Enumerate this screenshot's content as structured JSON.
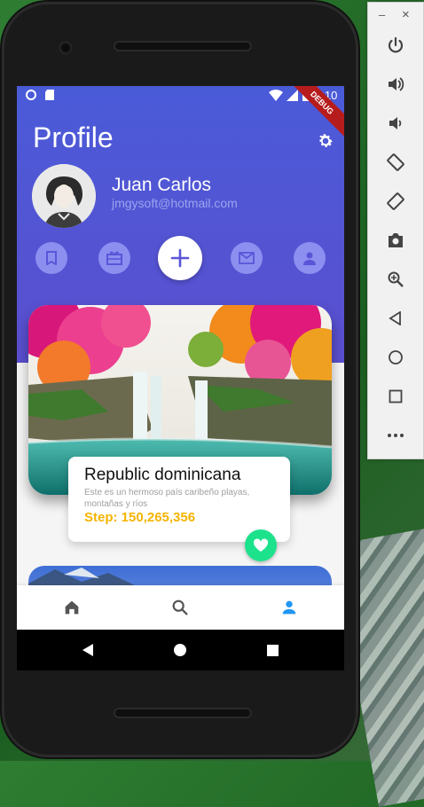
{
  "status_bar": {
    "time": "3:10",
    "debug_banner": "DEBUG"
  },
  "profile": {
    "title": "Profile",
    "name": "Juan Carlos",
    "email": "jmgysoft@hotmail.com"
  },
  "actions": [
    {
      "icon": "bookmark-icon"
    },
    {
      "icon": "gift-card-icon"
    },
    {
      "icon": "plus-icon"
    },
    {
      "icon": "mail-icon"
    },
    {
      "icon": "person-icon"
    }
  ],
  "featured": {
    "title": "Republic dominicana",
    "description": "Este es un hermoso país caribeño playas, montañas y ríos",
    "step": "Step: 150,265,356"
  },
  "bottom_nav": [
    "home-icon",
    "search-icon",
    "person-icon"
  ],
  "colors": {
    "header": "#4a5bd8",
    "accent_yellow": "#f5b400",
    "fav_green": "#1de28c",
    "nav_active": "#2196f3"
  },
  "emulator_panel": {
    "minimize": "–",
    "close": "×",
    "buttons": [
      "power-icon",
      "volume-up-icon",
      "volume-down-icon",
      "rotate-left-icon",
      "rotate-right-icon",
      "camera-icon",
      "zoom-icon",
      "back-icon",
      "home-icon",
      "overview-icon",
      "more-icon"
    ]
  }
}
